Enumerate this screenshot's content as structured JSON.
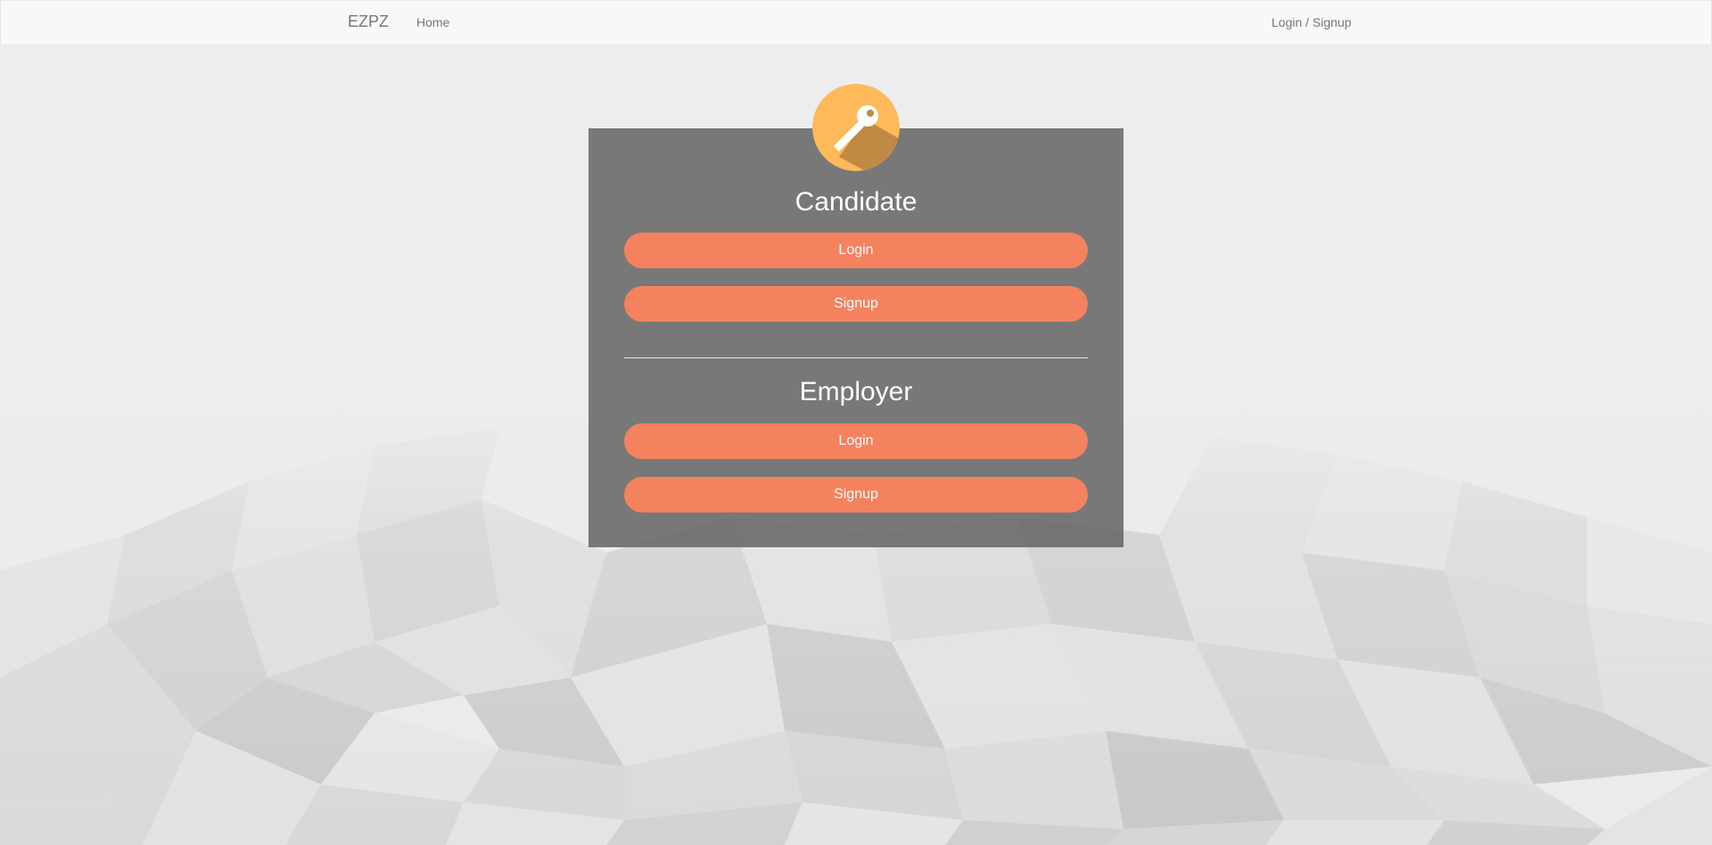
{
  "navbar": {
    "brand": "EZPZ",
    "home_label": "Home",
    "login_signup_label": "Login / Signup"
  },
  "auth_panel": {
    "icon": "key-icon",
    "candidate": {
      "title": "Candidate",
      "login_label": "Login",
      "signup_label": "Signup"
    },
    "employer": {
      "title": "Employer",
      "login_label": "Login",
      "signup_label": "Signup"
    }
  },
  "colors": {
    "button_accent": "#f4825f",
    "badge_circle": "#fdb95a",
    "panel_background": "#6e6e6e",
    "navbar_background": "#f8f8f8"
  }
}
